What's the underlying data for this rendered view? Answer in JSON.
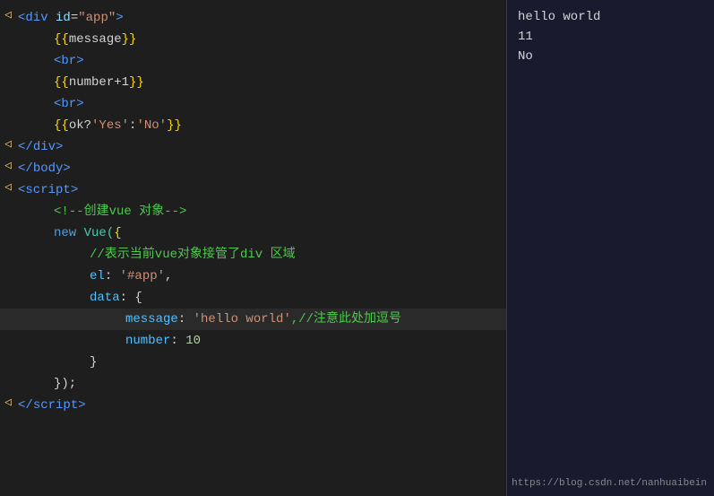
{
  "editor": {
    "lines": [
      {
        "id": 1,
        "gutter": "◁",
        "hasArrow": true,
        "indent": 0,
        "parts": [
          {
            "text": "<",
            "cls": "tag"
          },
          {
            "text": "div",
            "cls": "tag"
          },
          {
            "text": " id",
            "cls": "attr"
          },
          {
            "text": "=",
            "cls": "operator"
          },
          {
            "text": "\"app\"",
            "cls": "string"
          },
          {
            "text": ">",
            "cls": "tag"
          }
        ]
      },
      {
        "id": 2,
        "gutter": "",
        "indent": 1,
        "parts": [
          {
            "text": "{{",
            "cls": "bracket"
          },
          {
            "text": "message",
            "cls": "plain"
          },
          {
            "text": "}}",
            "cls": "bracket"
          }
        ]
      },
      {
        "id": 3,
        "gutter": "",
        "indent": 1,
        "parts": [
          {
            "text": "<",
            "cls": "tag"
          },
          {
            "text": "br",
            "cls": "tag"
          },
          {
            "text": ">",
            "cls": "tag"
          }
        ]
      },
      {
        "id": 4,
        "gutter": "",
        "indent": 1,
        "parts": [
          {
            "text": "{{",
            "cls": "bracket"
          },
          {
            "text": "number+1",
            "cls": "plain"
          },
          {
            "text": "}}",
            "cls": "bracket"
          }
        ]
      },
      {
        "id": 5,
        "gutter": "",
        "indent": 1,
        "parts": [
          {
            "text": "<",
            "cls": "tag"
          },
          {
            "text": "br",
            "cls": "tag"
          },
          {
            "text": ">",
            "cls": "tag"
          }
        ]
      },
      {
        "id": 6,
        "gutter": "",
        "indent": 1,
        "parts": [
          {
            "text": "{{",
            "cls": "bracket"
          },
          {
            "text": "ok?",
            "cls": "plain"
          },
          {
            "text": "'Yes'",
            "cls": "value-str"
          },
          {
            "text": ":",
            "cls": "operator"
          },
          {
            "text": "'No'",
            "cls": "value-str"
          },
          {
            "text": "}}",
            "cls": "bracket"
          }
        ]
      },
      {
        "id": 7,
        "gutter": "◁",
        "hasArrow": true,
        "indent": 0,
        "parts": [
          {
            "text": "</",
            "cls": "tag"
          },
          {
            "text": "div",
            "cls": "tag"
          },
          {
            "text": ">",
            "cls": "tag"
          }
        ]
      },
      {
        "id": 8,
        "gutter": "◁",
        "hasArrow": true,
        "indent": 0,
        "parts": [
          {
            "text": "</",
            "cls": "tag"
          },
          {
            "text": "body",
            "cls": "tag"
          },
          {
            "text": ">",
            "cls": "tag"
          }
        ]
      },
      {
        "id": 9,
        "gutter": "◁",
        "hasArrow": true,
        "indent": 0,
        "parts": [
          {
            "text": "<",
            "cls": "tag"
          },
          {
            "text": "script",
            "cls": "tag"
          },
          {
            "text": ">",
            "cls": "tag"
          }
        ]
      },
      {
        "id": 10,
        "gutter": "",
        "indent": 1,
        "parts": [
          {
            "text": "<!--",
            "cls": "comment"
          },
          {
            "text": "创建vue 对象",
            "cls": "comment"
          },
          {
            "text": "-->",
            "cls": "comment"
          }
        ]
      },
      {
        "id": 11,
        "gutter": "",
        "indent": 1,
        "parts": [
          {
            "text": "new",
            "cls": "vue-new"
          },
          {
            "text": " Vue(",
            "cls": "vue-class"
          },
          {
            "text": "{",
            "cls": "bracket"
          }
        ]
      },
      {
        "id": 12,
        "gutter": "",
        "indent": 2,
        "parts": [
          {
            "text": "//表示当前vue对象接管了div 区域",
            "cls": "comment"
          }
        ]
      },
      {
        "id": 13,
        "gutter": "",
        "indent": 2,
        "parts": [
          {
            "text": "el",
            "cls": "light-blue"
          },
          {
            "text": ": ",
            "cls": "plain"
          },
          {
            "text": "'#app'",
            "cls": "value-str"
          },
          {
            "text": ",",
            "cls": "plain"
          }
        ]
      },
      {
        "id": 14,
        "gutter": "",
        "indent": 2,
        "parts": [
          {
            "text": "data",
            "cls": "light-blue"
          },
          {
            "text": ": {",
            "cls": "plain"
          }
        ]
      },
      {
        "id": 15,
        "gutter": "",
        "indent": 3,
        "highlighted": true,
        "parts": [
          {
            "text": "message",
            "cls": "light-blue"
          },
          {
            "text": ": ",
            "cls": "plain"
          },
          {
            "text": "'hello world'",
            "cls": "value-str"
          },
          {
            "text": ",//注意此处加逗号",
            "cls": "comment"
          }
        ]
      },
      {
        "id": 16,
        "gutter": "",
        "indent": 3,
        "parts": [
          {
            "text": "number",
            "cls": "light-blue"
          },
          {
            "text": ": ",
            "cls": "plain"
          },
          {
            "text": "10",
            "cls": "value-num"
          }
        ]
      },
      {
        "id": 17,
        "gutter": "",
        "indent": 2,
        "parts": [
          {
            "text": "}",
            "cls": "plain"
          }
        ]
      },
      {
        "id": 18,
        "gutter": "",
        "indent": 1,
        "parts": [
          {
            "text": "});",
            "cls": "plain"
          }
        ]
      },
      {
        "id": 19,
        "gutter": "◁",
        "hasArrow": true,
        "indent": 0,
        "parts": [
          {
            "text": "</",
            "cls": "tag"
          },
          {
            "text": "script",
            "cls": "tag"
          },
          {
            "text": ">",
            "cls": "tag"
          }
        ]
      }
    ]
  },
  "output": {
    "lines": [
      "hello world",
      "11",
      "No"
    ]
  },
  "footer": {
    "url": "https://blog.csdn.net/nanhuaibein"
  }
}
